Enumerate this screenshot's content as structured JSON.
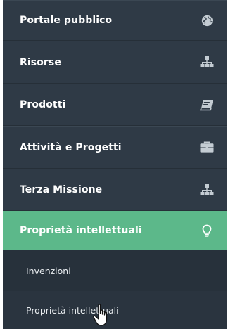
{
  "sidebar": {
    "items": [
      {
        "label": "Portale pubblico",
        "icon": "globe-icon"
      },
      {
        "label": "Risorse",
        "icon": "sitemap-icon"
      },
      {
        "label": "Prodotti",
        "icon": "book-icon"
      },
      {
        "label": "Attività e Progetti",
        "icon": "briefcase-icon"
      },
      {
        "label": "Terza Missione",
        "icon": "sitemap-icon"
      },
      {
        "label": "Proprietà intellettuali",
        "icon": "lightbulb-icon",
        "active": true
      }
    ],
    "subitems": [
      {
        "label": "Invenzioni"
      },
      {
        "label": "Proprietà intellettuali"
      }
    ]
  },
  "colors": {
    "sidebar_bg": "#2f3a46",
    "active_bg": "#5cb88a",
    "submenu_bg": "#27313b",
    "icon": "#c4ccd3"
  },
  "cursor": "hand-pointer-icon"
}
